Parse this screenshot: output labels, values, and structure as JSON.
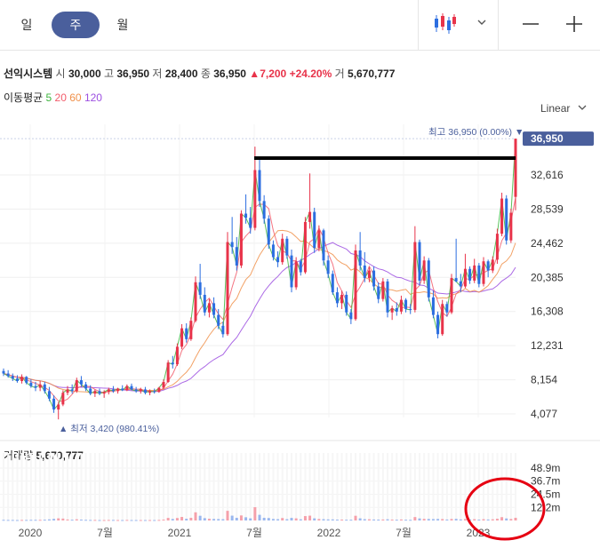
{
  "tabs": [
    {
      "label": "일",
      "active": false
    },
    {
      "label": "주",
      "active": true
    },
    {
      "label": "월",
      "active": false
    }
  ],
  "toolbar": {
    "chart_type_icon": "candlestick-icon",
    "dropdown_icon": "chevron-down-icon",
    "zoom_out_icon": "minus-icon",
    "zoom_in_icon": "plus-icon"
  },
  "stock": {
    "name": "선익시스템",
    "open_label": "시",
    "open": "30,000",
    "high_label": "고",
    "high": "36,950",
    "low_label": "저",
    "low": "28,400",
    "close_label": "종",
    "close": "36,950",
    "change": "7,200",
    "change_pct": "+24.20%",
    "volume_label": "거",
    "volume": "5,670,777"
  },
  "ma": {
    "label": "이동평균",
    "periods": [
      {
        "p": "5",
        "color": "#3db43d"
      },
      {
        "p": "20",
        "color": "#f25c6b"
      },
      {
        "p": "60",
        "color": "#f0904a"
      },
      {
        "p": "120",
        "color": "#9c4fe0"
      }
    ]
  },
  "scale": {
    "label": "Linear"
  },
  "volume_panel": {
    "label": "거래량",
    "value": "5,670,777"
  },
  "colors": {
    "up": "#e8334a",
    "down": "#2c6ee0",
    "accent": "#4a5f9c"
  },
  "chart_data": {
    "type": "candlestick",
    "price_axis": {
      "ticks": [
        4077,
        8154,
        12231,
        16308,
        20385,
        24462,
        28539,
        32616
      ],
      "labels": [
        "4,077",
        "8,154",
        "12,231",
        "16,308",
        "20,385",
        "24,462",
        "28,539",
        "32,616"
      ],
      "current": "36,950"
    },
    "max_marker": {
      "label": "최고",
      "value": "36,950",
      "pct": "(0.00%)"
    },
    "min_marker": {
      "label": "최저",
      "value": "3,420",
      "pct": "(980.41%)"
    },
    "volume_axis": {
      "ticks": [
        "48.9m",
        "36.7m",
        "24.5m",
        "12.2m"
      ]
    },
    "x_labels": [
      "2020",
      "7월",
      "2021",
      "7월",
      "2022",
      "7월",
      "2023"
    ],
    "ohlc": [
      [
        9200,
        9500,
        8600,
        8900
      ],
      [
        8900,
        9300,
        8400,
        8600
      ],
      [
        8600,
        8900,
        8000,
        8300
      ],
      [
        8300,
        8700,
        7800,
        8000
      ],
      [
        8000,
        8800,
        7700,
        8500
      ],
      [
        8500,
        8600,
        7600,
        7800
      ],
      [
        7800,
        8200,
        7200,
        7400
      ],
      [
        7400,
        7900,
        6800,
        7200
      ],
      [
        7200,
        8000,
        6800,
        7600
      ],
      [
        7600,
        7900,
        6500,
        6800
      ],
      [
        6800,
        7300,
        5600,
        5900
      ],
      [
        5900,
        6300,
        4200,
        4600
      ],
      [
        4600,
        5500,
        3420,
        5200
      ],
      [
        5200,
        6900,
        5000,
        6600
      ],
      [
        6600,
        7400,
        6300,
        7000
      ],
      [
        7000,
        7600,
        6500,
        6800
      ],
      [
        6800,
        8400,
        6600,
        8100
      ],
      [
        8100,
        8600,
        7300,
        7600
      ],
      [
        7600,
        7900,
        6800,
        7100
      ],
      [
        7100,
        7500,
        6300,
        6500
      ],
      [
        6500,
        7000,
        6100,
        6800
      ],
      [
        6800,
        7100,
        6300,
        6500
      ],
      [
        6500,
        6900,
        6000,
        6700
      ],
      [
        6700,
        7200,
        6400,
        7000
      ],
      [
        7000,
        7400,
        6600,
        6800
      ],
      [
        6800,
        7200,
        6500,
        7100
      ],
      [
        7100,
        7500,
        6800,
        6900
      ],
      [
        6900,
        7600,
        6800,
        7400
      ],
      [
        7400,
        7700,
        6900,
        7000
      ],
      [
        7000,
        7300,
        6600,
        6800
      ],
      [
        6800,
        7200,
        6500,
        7000
      ],
      [
        7000,
        7300,
        6400,
        6600
      ],
      [
        6600,
        7000,
        6300,
        6800
      ],
      [
        6800,
        7100,
        6500,
        6700
      ],
      [
        6700,
        7300,
        6600,
        7200
      ],
      [
        7200,
        8200,
        7000,
        7900
      ],
      [
        7900,
        10500,
        7800,
        10200
      ],
      [
        10200,
        11000,
        9500,
        10000
      ],
      [
        10000,
        12500,
        9800,
        12100
      ],
      [
        12100,
        14800,
        11800,
        14300
      ],
      [
        14300,
        14900,
        12600,
        13000
      ],
      [
        13000,
        15600,
        12800,
        15200
      ],
      [
        15200,
        20500,
        15000,
        19800
      ],
      [
        19800,
        22000,
        17800,
        18300
      ],
      [
        18300,
        19200,
        15800,
        16200
      ],
      [
        16200,
        17800,
        15600,
        17300
      ],
      [
        17300,
        18000,
        15500,
        15900
      ],
      [
        15900,
        16600,
        14200,
        14600
      ],
      [
        14600,
        15100,
        13200,
        13600
      ],
      [
        13600,
        25800,
        13400,
        24600
      ],
      [
        24600,
        27600,
        23200,
        24000
      ],
      [
        24000,
        25200,
        21200,
        21800
      ],
      [
        21800,
        28400,
        21500,
        28000
      ],
      [
        28000,
        30300,
        26800,
        27500
      ],
      [
        27500,
        28800,
        25600,
        26300
      ],
      [
        26300,
        36000,
        26000,
        33200
      ],
      [
        33200,
        34500,
        28800,
        29500
      ],
      [
        29500,
        30200,
        26800,
        27400
      ],
      [
        27400,
        27800,
        23800,
        24300
      ],
      [
        24300,
        24800,
        22400,
        22800
      ],
      [
        22800,
        23500,
        21600,
        22200
      ],
      [
        22200,
        25600,
        21900,
        25000
      ],
      [
        25000,
        25300,
        22600,
        23000
      ],
      [
        23000,
        23700,
        18600,
        19200
      ],
      [
        19200,
        22800,
        18900,
        22300
      ],
      [
        22300,
        22600,
        20600,
        21000
      ],
      [
        21000,
        27600,
        20800,
        27000
      ],
      [
        27000,
        32800,
        26200,
        28200
      ],
      [
        28200,
        28700,
        23300,
        23900
      ],
      [
        23900,
        26600,
        23500,
        26000
      ],
      [
        26000,
        26200,
        21800,
        22400
      ],
      [
        22400,
        23000,
        20300,
        20800
      ],
      [
        20800,
        21200,
        18300,
        18600
      ],
      [
        18600,
        19200,
        16800,
        17300
      ],
      [
        17300,
        18800,
        16600,
        18300
      ],
      [
        18300,
        18700,
        15800,
        16200
      ],
      [
        16200,
        16600,
        14800,
        15400
      ],
      [
        15400,
        24300,
        15200,
        23600
      ],
      [
        23600,
        25800,
        21200,
        21800
      ],
      [
        21800,
        23400,
        19800,
        20300
      ],
      [
        20300,
        21600,
        19800,
        21200
      ],
      [
        21200,
        21700,
        18800,
        19300
      ],
      [
        19300,
        19800,
        17300,
        17800
      ],
      [
        17800,
        20300,
        17500,
        19900
      ],
      [
        19900,
        20200,
        15600,
        16200
      ],
      [
        16200,
        17000,
        15300,
        16700
      ],
      [
        16700,
        17400,
        15800,
        16300
      ],
      [
        16300,
        18200,
        16000,
        17700
      ],
      [
        17700,
        17900,
        16200,
        16600
      ],
      [
        16600,
        17200,
        16000,
        16500
      ],
      [
        16500,
        26500,
        16200,
        24600
      ],
      [
        24600,
        24900,
        19400,
        20000
      ],
      [
        20000,
        22900,
        19600,
        22400
      ],
      [
        22400,
        22700,
        17500,
        18000
      ],
      [
        18000,
        18800,
        15500,
        15900
      ],
      [
        15900,
        16300,
        13100,
        13600
      ],
      [
        13600,
        17700,
        13400,
        17200
      ],
      [
        17200,
        17500,
        15700,
        16200
      ],
      [
        16200,
        20800,
        16000,
        20300
      ],
      [
        20300,
        25000,
        19800,
        19900
      ],
      [
        19900,
        20800,
        18600,
        19300
      ],
      [
        19300,
        23200,
        19100,
        21400
      ],
      [
        21400,
        21700,
        19600,
        20000
      ],
      [
        20000,
        22600,
        19700,
        21800
      ],
      [
        21800,
        22100,
        19200,
        19600
      ],
      [
        19600,
        22800,
        19300,
        22300
      ],
      [
        22300,
        22500,
        20400,
        21200
      ],
      [
        21200,
        22900,
        20900,
        22500
      ],
      [
        22500,
        26200,
        22000,
        25600
      ],
      [
        25600,
        30500,
        25300,
        29800
      ],
      [
        29800,
        30200,
        24300,
        24800
      ],
      [
        24800,
        28600,
        24500,
        28100
      ],
      [
        30000,
        36950,
        28400,
        36950
      ]
    ],
    "volume": [
      0.6,
      0.5,
      0.5,
      0.4,
      0.5,
      0.5,
      0.6,
      0.6,
      0.6,
      0.7,
      1.0,
      1.5,
      2.0,
      1.8,
      0.9,
      0.7,
      1.1,
      0.8,
      0.6,
      0.5,
      0.5,
      0.4,
      0.4,
      0.5,
      0.5,
      0.4,
      0.4,
      0.5,
      0.4,
      0.4,
      0.4,
      0.4,
      0.4,
      0.4,
      0.5,
      0.8,
      2.4,
      1.4,
      2.3,
      3.3,
      1.6,
      2.5,
      7.6,
      4.4,
      2.2,
      1.6,
      1.4,
      1.3,
      1.2,
      9.0,
      4.5,
      2.5,
      4.7,
      3.0,
      2.0,
      12.4,
      5.3,
      2.5,
      2.3,
      1.4,
      1.2,
      2.3,
      1.2,
      2.4,
      2.0,
      1.1,
      4.1,
      4.5,
      2.0,
      1.4,
      1.2,
      1.0,
      1.0,
      0.8,
      0.8,
      0.7,
      0.7,
      4.4,
      2.0,
      1.2,
      1.1,
      0.9,
      0.8,
      0.9,
      1.1,
      0.8,
      0.7,
      0.9,
      0.7,
      0.6,
      3.2,
      1.9,
      1.5,
      1.4,
      1.3,
      1.4,
      1.3,
      0.9,
      1.4,
      1.5,
      1.0,
      1.3,
      0.9,
      1.2,
      0.8,
      1.2,
      0.9,
      1.1,
      1.6,
      3.1,
      1.9,
      1.4,
      2.5
    ]
  }
}
